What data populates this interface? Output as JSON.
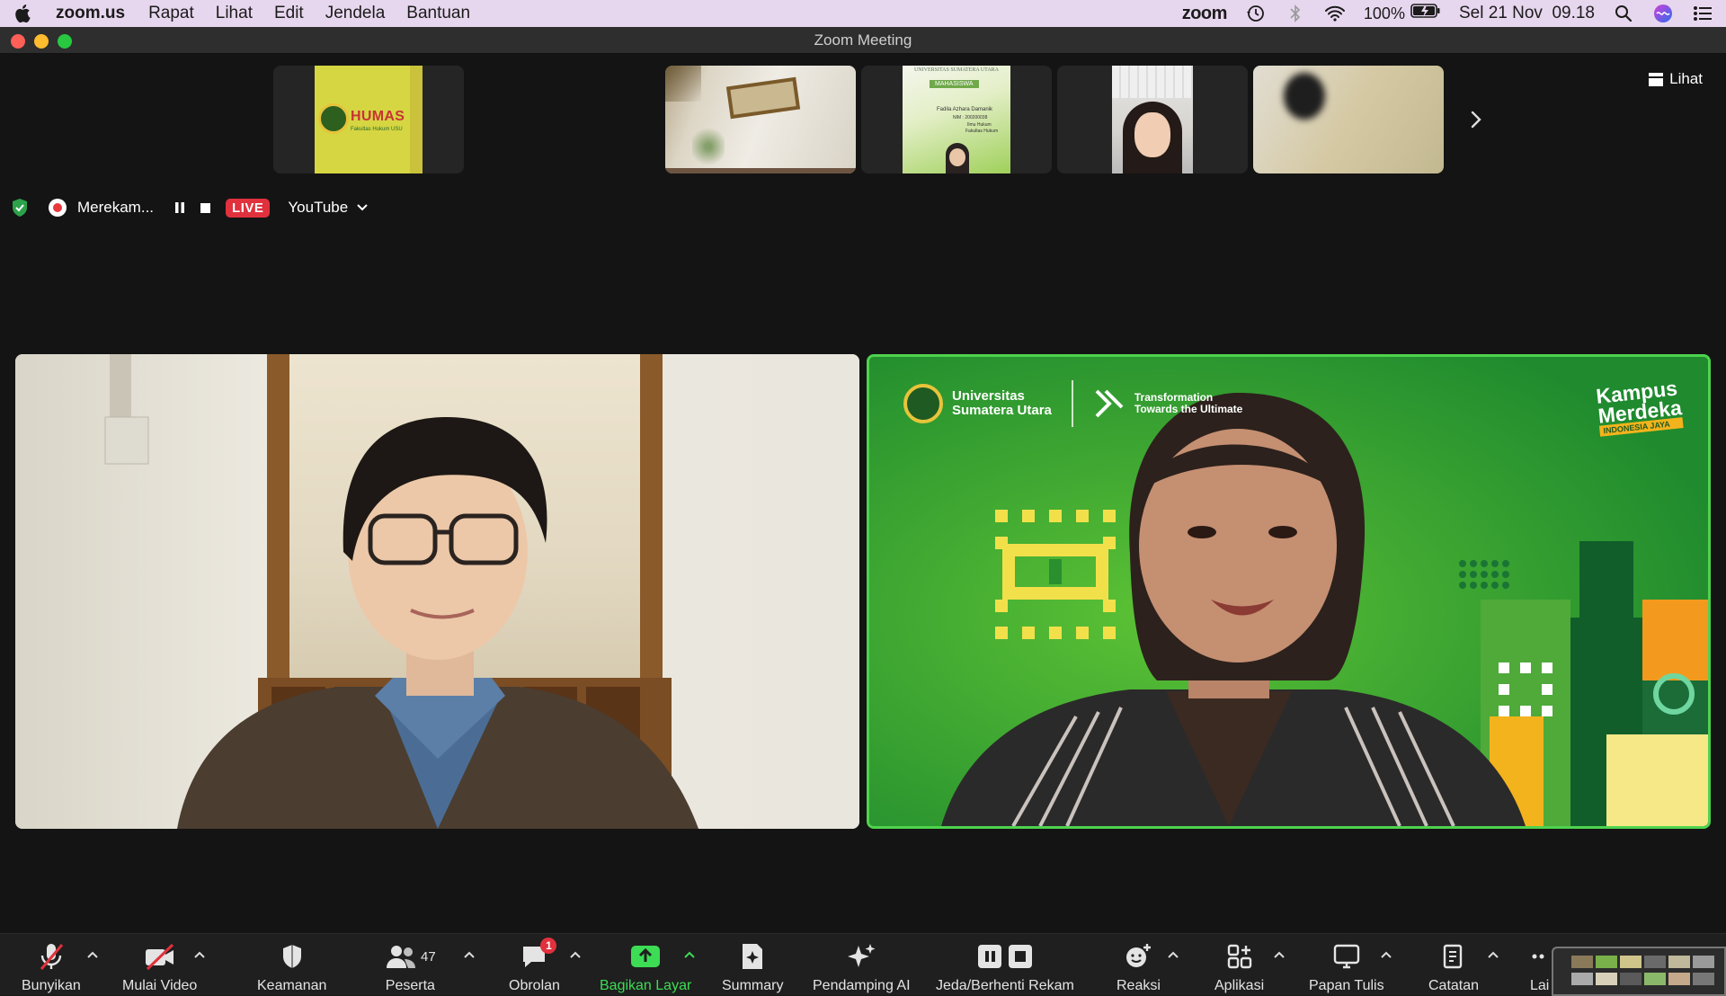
{
  "menubar": {
    "app_name": "zoom.us",
    "menus": [
      "Rapat",
      "Lihat",
      "Edit",
      "Jendela",
      "Bantuan"
    ],
    "zoom_logo": "zoom",
    "battery": "100%",
    "datetime": "Sel 21 Nov  09.18"
  },
  "window": {
    "title": "Zoom Meeting"
  },
  "top_bar": {
    "view_label": "Lihat"
  },
  "thumbnails": {
    "humas_title": "HUMAS",
    "humas_sub": "Fakultas Hukum USU",
    "slide_header": "UNIVERSITAS SUMATERA UTARA",
    "slide_tag": "MAHASISWA",
    "slide_name": "Fadila Azhara Damanik",
    "slide_nim": "NIM : 200200038",
    "slide_l1": "Ilmu Hukum",
    "slide_l2": "Fakultas Hukum"
  },
  "recording": {
    "label": "Merekam...",
    "live_badge": "LIVE",
    "stream_target": "YouTube"
  },
  "speaker_right": {
    "univ_line1": "Universitas",
    "univ_line2": "Sumatera Utara",
    "tagline1": "Transformation",
    "tagline2": "Towards the Ultimate",
    "brand1": "Kampus",
    "brand2": "Merdeka",
    "brand3": "INDONESIA JAYA"
  },
  "toolbar": {
    "items": [
      {
        "label": "Bunyikan",
        "icon": "mic-muted-icon"
      },
      {
        "label": "Mulai Video",
        "icon": "video-off-icon"
      },
      {
        "label": "Keamanan",
        "icon": "shield-icon"
      },
      {
        "label": "Peserta",
        "icon": "participants-icon",
        "count": "47"
      },
      {
        "label": "Obrolan",
        "icon": "chat-icon",
        "badge": "1"
      },
      {
        "label": "Bagikan Layar",
        "icon": "share-screen-icon"
      },
      {
        "label": "Summary",
        "icon": "summary-icon"
      },
      {
        "label": "Pendamping AI",
        "icon": "ai-sparkle-icon"
      },
      {
        "label": "Jeda/Berhenti Rekam",
        "icon": "pause-stop-icon"
      },
      {
        "label": "Reaksi",
        "icon": "reaction-icon"
      },
      {
        "label": "Aplikasi",
        "icon": "apps-icon"
      },
      {
        "label": "Papan Tulis",
        "icon": "whiteboard-icon"
      },
      {
        "label": "Catatan",
        "icon": "notes-icon"
      },
      {
        "label": "Lai",
        "icon": "more-icon"
      }
    ]
  },
  "colors": {
    "accent_green": "#3ddc55",
    "live_red": "#e0313d",
    "active_speaker_border": "#4ed34e"
  }
}
